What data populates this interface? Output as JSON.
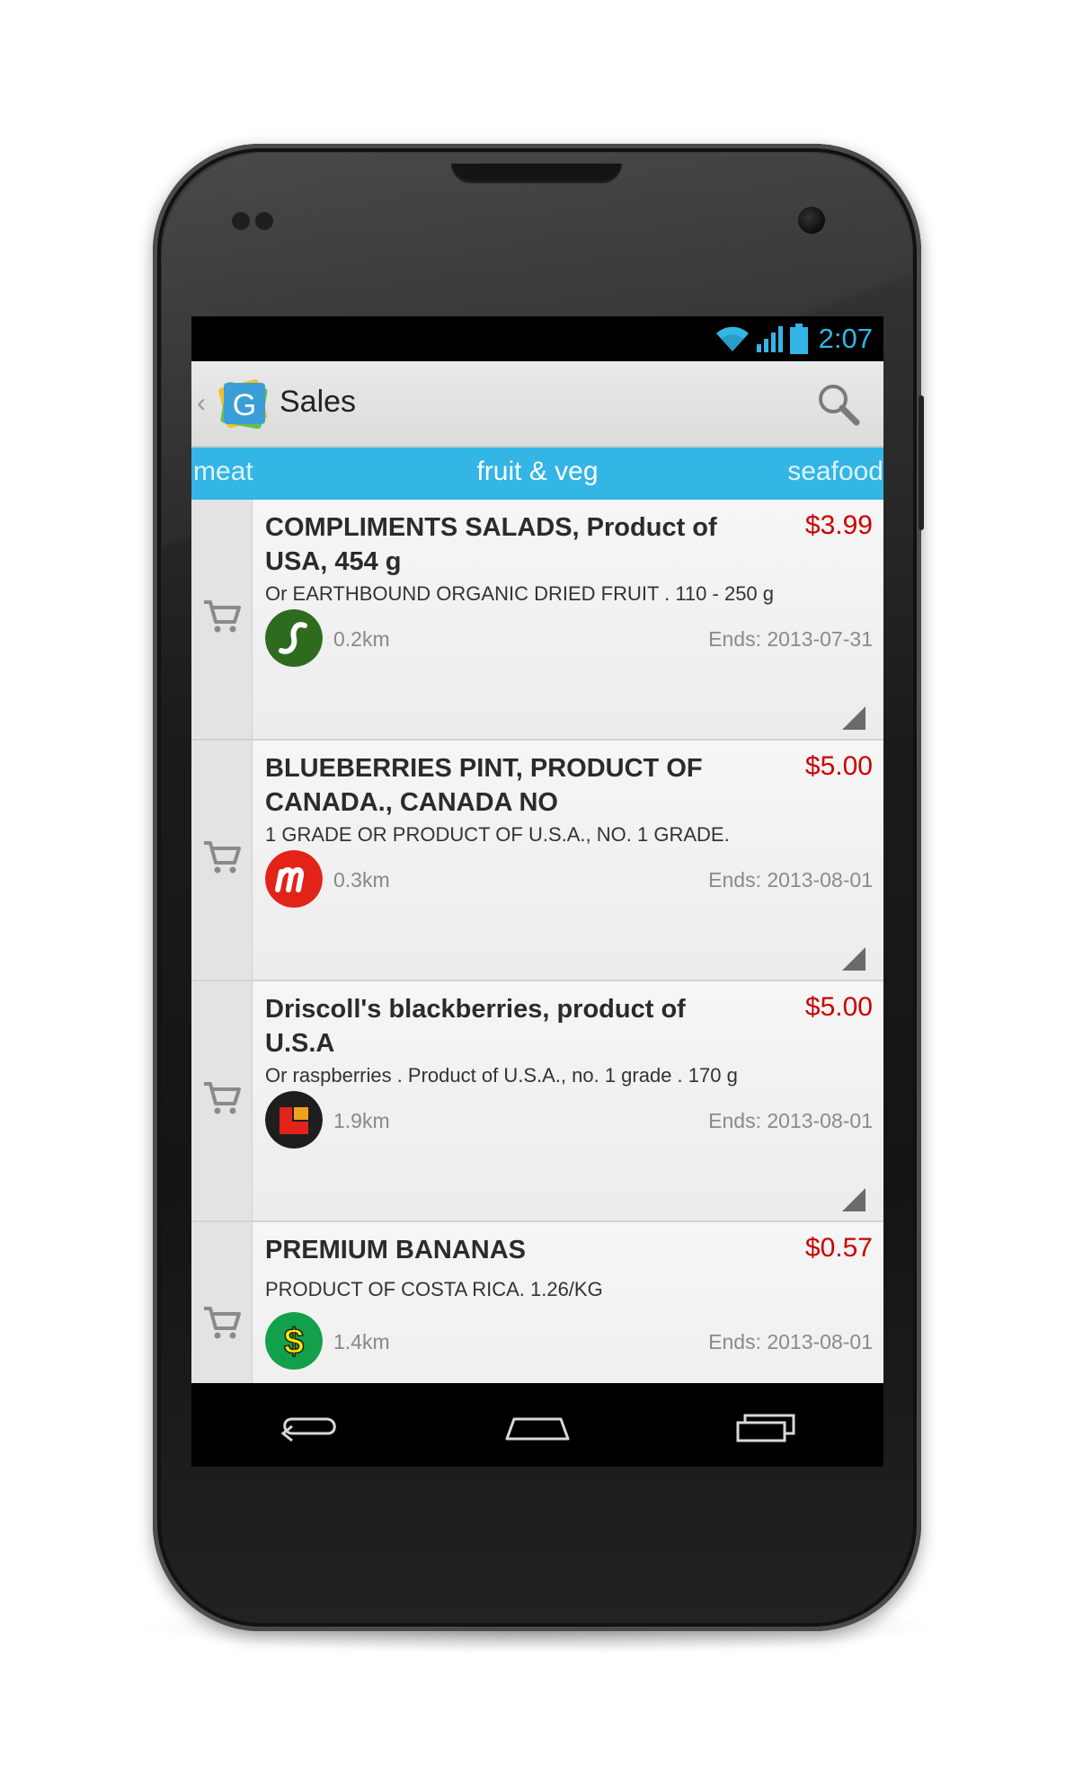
{
  "status_bar": {
    "time": "2:07",
    "icons": [
      "wifi-icon",
      "signal-icon",
      "battery-icon"
    ]
  },
  "action_bar": {
    "up_caret": "‹",
    "logo_letter": "G",
    "title": "Sales",
    "search_icon": "search-icon"
  },
  "tabs": {
    "left": "meat",
    "selected": "fruit & veg",
    "right": "seafood"
  },
  "colors": {
    "accent": "#33b5e5",
    "price": "#cc0000"
  },
  "items": [
    {
      "title": "COMPLIMENTS SALADS, Product of USA, 454 g",
      "price": "$3.99",
      "description": "Or EARTHBOUND ORGANIC DRIED FRUIT . 110 - 250 g",
      "store_icon": "sobeys-logo-icon",
      "distance": "0.2km",
      "ends": "Ends: 2013-07-31"
    },
    {
      "title": "BLUEBERRIES PINT, PRODUCT OF CANADA., CANADA NO",
      "price": "$5.00",
      "description": "1 GRADE OR PRODUCT OF U.S.A., NO. 1 GRADE.",
      "store_icon": "metro-logo-icon",
      "distance": "0.3km",
      "ends": "Ends: 2013-08-01"
    },
    {
      "title": "Driscoll's blackberries, product of U.S.A",
      "price": "$5.00",
      "description": "Or raspberries . Product of U.S.A., no. 1 grade . 170 g",
      "store_icon": "loblaws-logo-icon",
      "distance": "1.9km",
      "ends": "Ends: 2013-08-01"
    },
    {
      "title": "PREMIUM BANANAS",
      "price": "$0.57",
      "description": "PRODUCT OF COSTA RICA. 1.26/KG",
      "store_icon": "dollar-logo-icon",
      "distance": "1.4km",
      "ends": "Ends: 2013-08-01"
    }
  ],
  "nav_bar": [
    "back-icon",
    "home-icon",
    "recent-apps-icon"
  ]
}
